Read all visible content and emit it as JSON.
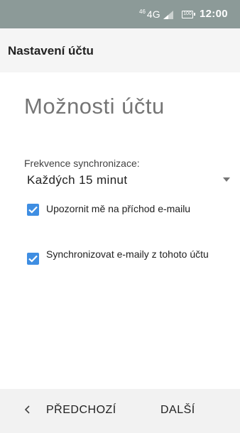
{
  "status_bar": {
    "network_sup": "46",
    "network": "4G",
    "battery": "100",
    "time": "12:00"
  },
  "app_bar": {
    "title": "Nastavení účtu"
  },
  "main": {
    "heading": "Možnosti účtu",
    "sync_frequency": {
      "label": "Frekvence synchronizace:",
      "value": "Každých 15 minut"
    },
    "options": [
      {
        "label": "Upozornit mě na příchod e-mailu",
        "checked": true
      },
      {
        "label": "Synchronizovat e-maily z tohoto účtu",
        "checked": true
      }
    ]
  },
  "bottom_bar": {
    "prev_label": "PŘEDCHOZÍ",
    "next_label": "DALŠÍ"
  },
  "colors": {
    "status_bar": "#8c9a98",
    "checkbox_accent": "#3f8ee2",
    "heading_text": "#757575"
  }
}
